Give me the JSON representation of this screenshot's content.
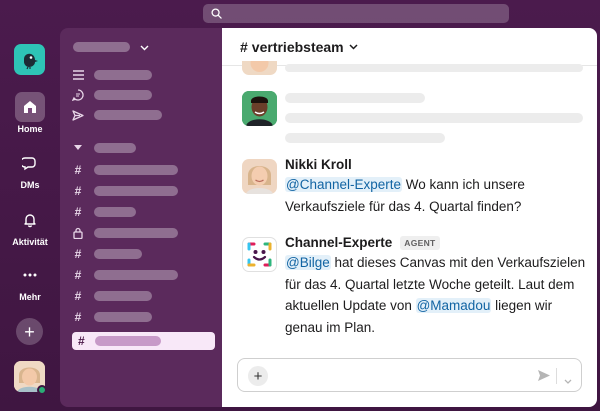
{
  "channel": {
    "hash": "#",
    "name": "vertriebsteam"
  },
  "rail": {
    "items": [
      {
        "label": "Home"
      },
      {
        "label": "DMs"
      },
      {
        "label": "Aktivität"
      },
      {
        "label": "Mehr"
      }
    ],
    "add_symbol": "+"
  },
  "sidebar": {
    "channel_glyph": "#"
  },
  "messages": [
    {
      "sender": "Nikki Kroll",
      "mention": "@Channel-Experte",
      "text_after_mention": " Wo kann ich unsere Verkaufsziele für das 4. Quartal finden?"
    },
    {
      "sender": "Channel-Experte",
      "badge": "AGENT",
      "mention1": "@Bilge",
      "text_mid": " hat dieses Canvas mit den Verkaufszielen für das 4. Quartal letzte Woche geteilt. Laut dem aktuellen Update von ",
      "mention2": "@Mamadou",
      "text_end": " liegen wir genau im Plan."
    }
  ],
  "composer": {
    "add_symbol": "+"
  },
  "colors": {
    "aubergine": "#4a1748",
    "sidebar": "#5b2a5c",
    "logo": "#2ec4b6",
    "mention_bg": "#e3f0f9",
    "mention_text": "#1264a3",
    "presence": "#2bac76"
  },
  "icons": [
    "search-icon",
    "bird-logo-icon",
    "home-icon",
    "dms-icon",
    "bell-icon",
    "more-icon",
    "threads-icon",
    "chat-icon",
    "send-outline-icon",
    "lock-icon",
    "send-icon",
    "chevron-down-icon"
  ]
}
